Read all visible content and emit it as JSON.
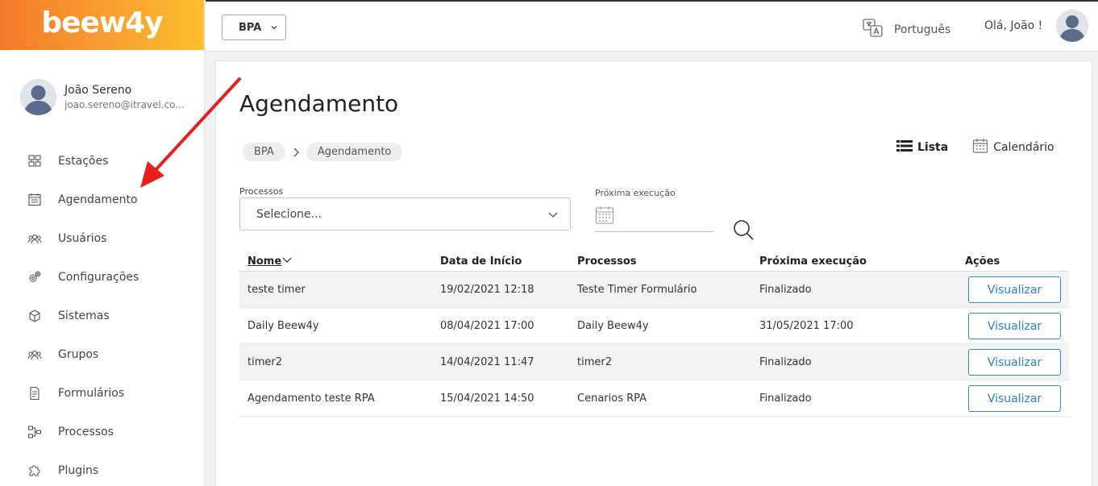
{
  "brand": {
    "logo_text": "beew4y"
  },
  "user": {
    "name": "João Sereno",
    "email": "joao.sereno@itravel.co..."
  },
  "sidebar": {
    "items": [
      {
        "label": "Estações",
        "icon": "stations-icon"
      },
      {
        "label": "Agendamento",
        "icon": "calendar-list-icon"
      },
      {
        "label": "Usuários",
        "icon": "users-icon"
      },
      {
        "label": "Configurações",
        "icon": "gears-icon"
      },
      {
        "label": "Sistemas",
        "icon": "cube-icon"
      },
      {
        "label": "Grupos",
        "icon": "group-icon"
      },
      {
        "label": "Formulários",
        "icon": "form-icon"
      },
      {
        "label": "Processos",
        "icon": "process-icon"
      },
      {
        "label": "Plugins",
        "icon": "puzzle-icon"
      }
    ]
  },
  "topbar": {
    "module": "BPA",
    "language": "Português",
    "greeting": "Olá, João !"
  },
  "main": {
    "title": "Agendamento",
    "breadcrumb": [
      "BPA",
      "Agendamento"
    ],
    "view_toggle": {
      "list": "Lista",
      "calendar": "Calendário"
    },
    "filters": {
      "process_label": "Processos",
      "process_value": "Selecione...",
      "next_exec_label": "Próxima execução"
    },
    "table": {
      "headers": [
        "Nome",
        "Data de Início",
        "Processos",
        "Próxima execução",
        "Ações"
      ],
      "rows": [
        {
          "name": "teste timer",
          "start": "19/02/2021 12:18",
          "process": "Teste Timer Formulário",
          "next": "Finalizado",
          "action": "Visualizar"
        },
        {
          "name": "Daily Beew4y",
          "start": "08/04/2021 17:00",
          "process": "Daily Beew4y",
          "next": "31/05/2021 17:00",
          "action": "Visualizar"
        },
        {
          "name": "timer2",
          "start": "14/04/2021 11:47",
          "process": "timer2",
          "next": "Finalizado",
          "action": "Visualizar"
        },
        {
          "name": "Agendamento teste RPA",
          "start": "15/04/2021 14:50",
          "process": "Cenarios RPA",
          "next": "Finalizado",
          "action": "Visualizar"
        }
      ]
    }
  },
  "colors": {
    "accent": "#2c80c4",
    "brand_start": "#f47a2a",
    "brand_end": "#fcbf2d",
    "annotation": "#e8201c"
  }
}
